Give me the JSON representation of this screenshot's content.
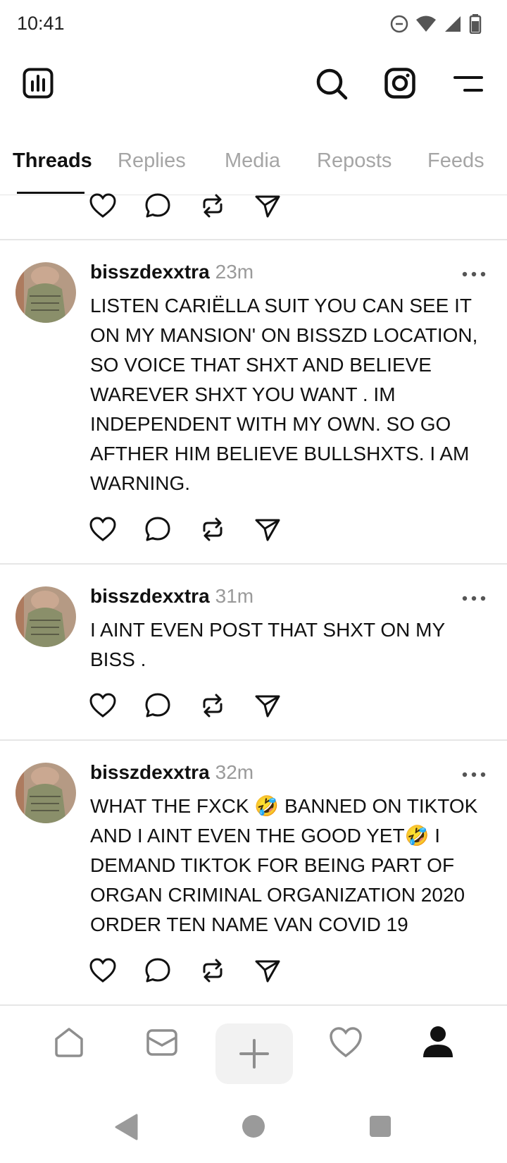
{
  "status_bar": {
    "time": "10:41"
  },
  "tabs": [
    {
      "label": "Threads",
      "active": true
    },
    {
      "label": "Replies"
    },
    {
      "label": "Media"
    },
    {
      "label": "Reposts"
    },
    {
      "label": "Feeds"
    }
  ],
  "icons": {
    "insights": "bar-chart-icon",
    "search": "search-icon",
    "instagram": "instagram-icon",
    "menu": "menu-icon",
    "like": "heart-icon",
    "reply": "comment-icon",
    "repost": "repost-icon",
    "share": "send-icon"
  },
  "posts": [
    {
      "username": "bisszdexxtra",
      "time": "23m",
      "text": "LISTEN CARIËLLA SUIT YOU CAN SEE IT ON MY MANSION' ON BISSZD LOCATION, SO VOICE THAT SHXT AND BELIEVE WAREVER SHXT YOU WANT . IM INDEPENDENT WITH MY OWN. SO GO AFTHER HIM BELIEVE BULLSHXTS. I AM WARNING."
    },
    {
      "username": "bisszdexxtra",
      "time": "31m",
      "text": "I AINT EVEN POST THAT SHXT ON MY BISS ."
    },
    {
      "username": "bisszdexxtra",
      "time": "32m",
      "text": "WHAT THE FXCK 🤣 BANNED ON TIKTOK AND I AINT EVEN THE GOOD YET🤣 I DEMAND TIKTOK FOR BEING PART OF ORGAN CRIMINAL ORGANIZATION 2020 ORDER TEN NAME VAN COVID 19"
    }
  ],
  "bottom_nav": [
    "home-icon",
    "inbox-icon",
    "compose-icon",
    "activity-icon",
    "profile-icon"
  ],
  "system_nav": [
    "back-icon",
    "home-circle-icon",
    "recents-icon"
  ]
}
